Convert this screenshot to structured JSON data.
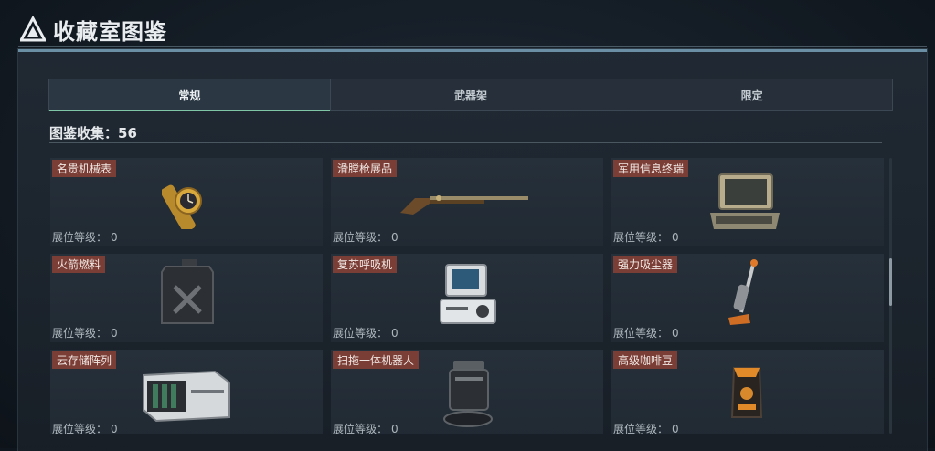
{
  "header": {
    "title": "收藏室图鉴",
    "icon": "triangle-logo-icon"
  },
  "tabs": [
    {
      "label": "常规",
      "active": true
    },
    {
      "label": "武器架",
      "active": false
    },
    {
      "label": "限定",
      "active": false
    }
  ],
  "collection": {
    "label": "图鉴收集：56"
  },
  "level_label": "展位等级：",
  "items": [
    {
      "name": "名贵机械表",
      "level": "0",
      "icon": "gold-watch-icon"
    },
    {
      "name": "滑膛枪展品",
      "level": "0",
      "icon": "musket-icon"
    },
    {
      "name": "军用信息终端",
      "level": "0",
      "icon": "military-terminal-icon"
    },
    {
      "name": "火箭燃料",
      "level": "0",
      "icon": "fuel-canister-icon"
    },
    {
      "name": "复苏呼吸机",
      "level": "0",
      "icon": "ventilator-icon"
    },
    {
      "name": "强力吸尘器",
      "level": "0",
      "icon": "vacuum-cleaner-icon"
    },
    {
      "name": "云存储阵列",
      "level": "0",
      "icon": "storage-array-icon"
    },
    {
      "name": "扫拖一体机器人",
      "level": "0",
      "icon": "robot-mop-icon"
    },
    {
      "name": "高级咖啡豆",
      "level": "0",
      "icon": "coffee-bag-icon"
    }
  ],
  "colors": {
    "accent": "#7ec6a6",
    "name_tag": "#7b3e36",
    "border_top": "#6b8fa5"
  }
}
